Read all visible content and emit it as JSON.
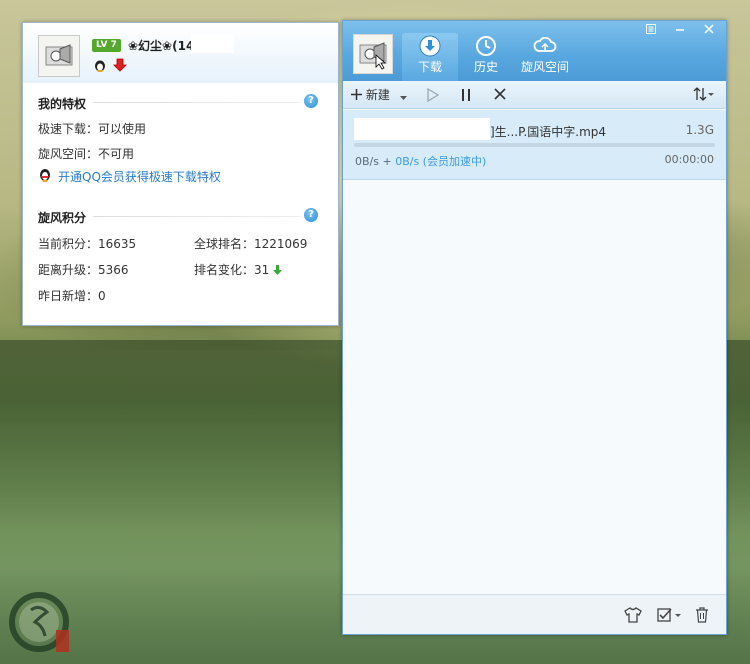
{
  "info_panel": {
    "level_badge": "LV 7",
    "username": "❀幻尘❀(14",
    "privilege_title": "我的特权",
    "fast_download": "极速下载：可以使用",
    "cyclone_space": "旋风空间：不可用",
    "qq_vip_link": "开通QQ会员获得极速下载特权",
    "points_title": "旋风积分",
    "current_points": "当前积分：16635",
    "global_rank": "全球排名：1221069",
    "to_upgrade": "距离升级：5366",
    "rank_change": "排名变化：31",
    "new_yesterday": "昨日新增：0",
    "help_glyph": "?"
  },
  "downloader": {
    "tabs": [
      {
        "label": "下载",
        "icon": "download-icon"
      },
      {
        "label": "历史",
        "icon": "clock-icon"
      },
      {
        "label": "旋风空间",
        "icon": "cloud-icon"
      }
    ],
    "toolbar": {
      "new_label": "新建",
      "sort_icon": "sort-icon"
    },
    "task": {
      "name": "]生...P.国语中字.mp4",
      "size": "1.3G",
      "speed": "0B/s",
      "plus": " + ",
      "accel_speed": "0B/s (会员加速中)",
      "eta": "00:00:00",
      "progress": 0
    }
  },
  "colors": {
    "accent": "#4d9bd6",
    "link": "#2a7cc9",
    "level_badge": "#54a82c"
  }
}
